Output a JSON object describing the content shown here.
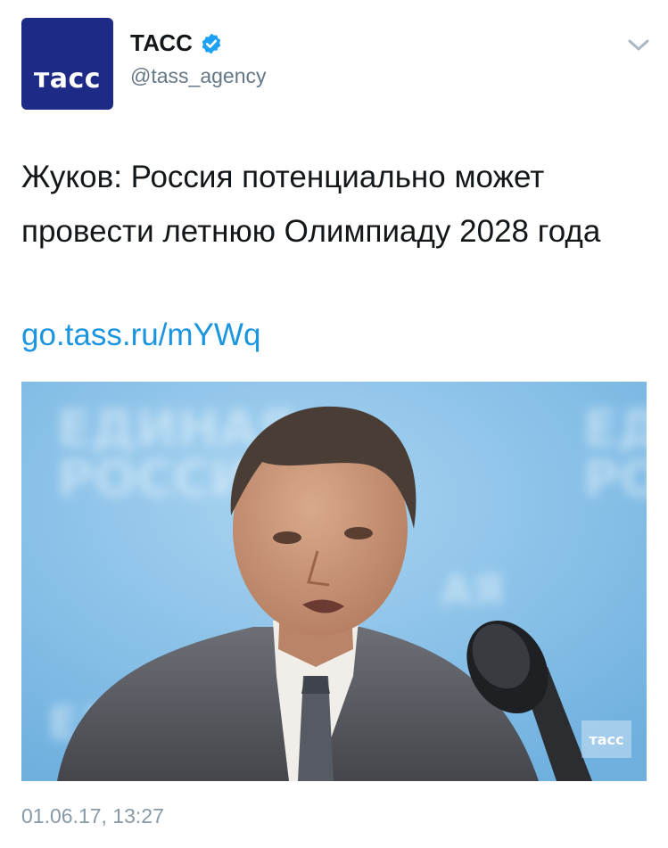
{
  "account": {
    "avatar_text": "тасс",
    "display_name": "ТАСС",
    "handle": "@tass_agency",
    "verified": true
  },
  "tweet": {
    "text": "Жуков: Россия потенциально может провести летнюю Олимпиаду 2028 года",
    "link": "go.tass.ru/mYWq",
    "timestamp": "01.06.17, 13:27"
  },
  "media": {
    "backdrop_text": [
      "ЕДИНАЯ",
      "РОССИЯ"
    ],
    "watermark": "тасс"
  },
  "icons": {
    "verified": "verified-badge-icon",
    "menu": "chevron-down-icon"
  },
  "colors": {
    "avatar_bg": "#1d2a86",
    "link": "#1b95e0",
    "verified": "#1da1f2",
    "secondary_text": "#657786",
    "photo_bg": "#8fc3e8"
  }
}
